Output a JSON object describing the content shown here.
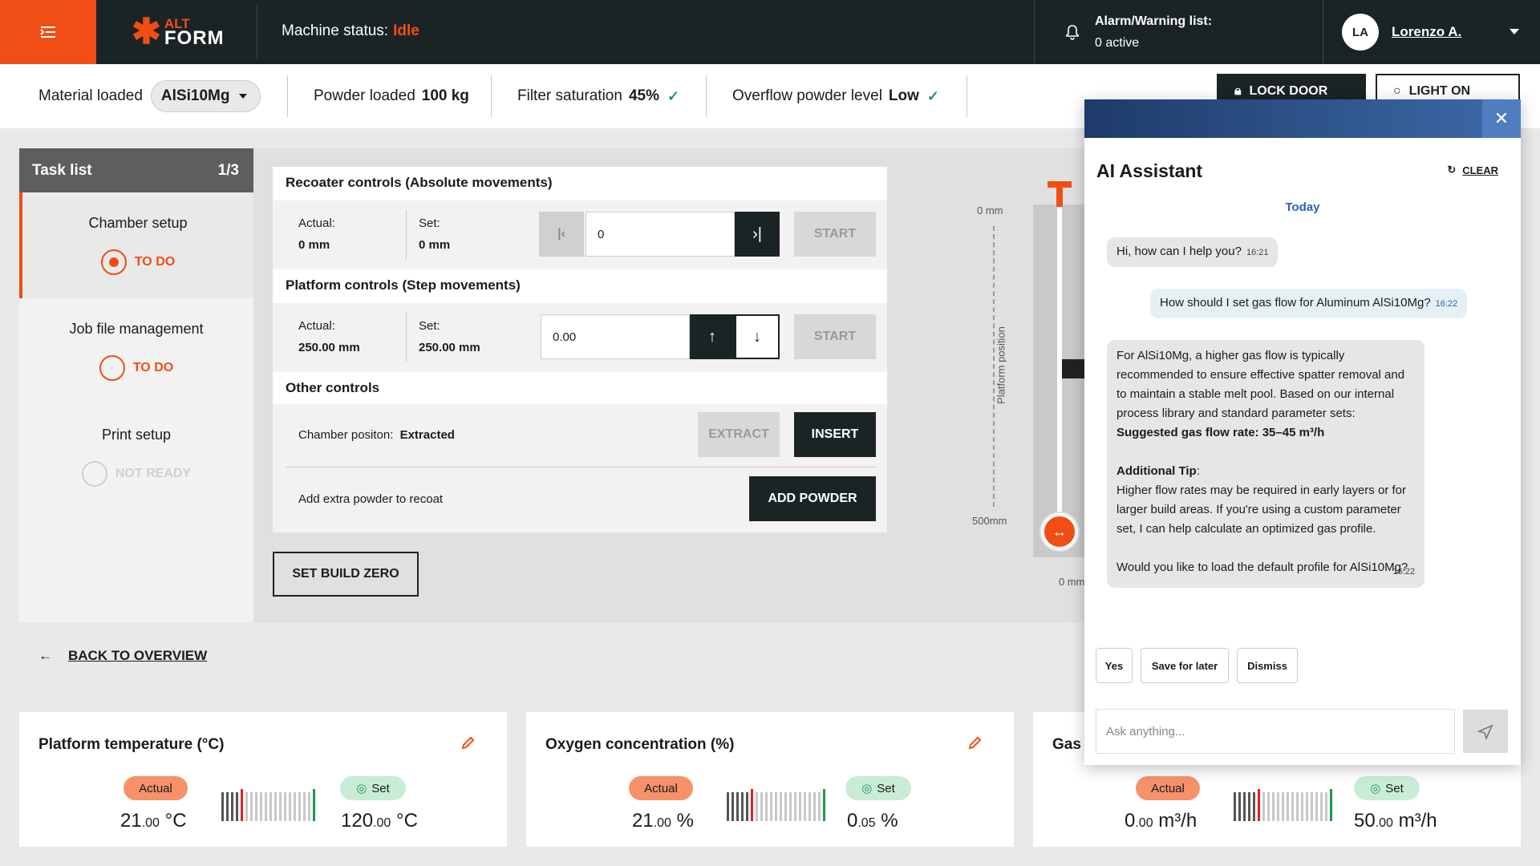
{
  "header": {
    "logo_alt": "ALT",
    "logo_form": "FORM",
    "machine_status_label": "Machine status:",
    "machine_status_value": "Idle",
    "alarm_title": "Alarm/Warning list:",
    "alarm_count": "0 active",
    "user_initials": "LA",
    "user_name": "Lorenzo A."
  },
  "status_strip": {
    "material_label": "Material loaded",
    "material_value": "AlSi10Mg",
    "powder_label": "Powder loaded",
    "powder_value": "100 kg",
    "filter_label": "Filter saturation",
    "filter_value": "45%",
    "overflow_label": "Overflow powder level",
    "overflow_value": "Low",
    "lock_door": "LOCK DOOR",
    "light_on": "LIGHT ON"
  },
  "tasks": {
    "title": "Task list",
    "progress": "1/3",
    "items": [
      {
        "name": "Chamber setup",
        "state": "TO DO"
      },
      {
        "name": "Job file management",
        "state": "TO DO"
      },
      {
        "name": "Print setup",
        "state": "NOT READY"
      }
    ]
  },
  "recoater": {
    "title": "Recoater controls (Absolute movements)",
    "actual_label": "Actual:",
    "actual_value": "0 mm",
    "set_label": "Set:",
    "set_value": "0 mm",
    "input_value": "0",
    "start": "START"
  },
  "platform": {
    "title": "Platform controls (Step movements)",
    "actual_label": "Actual:",
    "actual_value": "250.00 mm",
    "set_label": "Set:",
    "set_value": "250.00 mm",
    "input_value": "0.00",
    "start": "START"
  },
  "other": {
    "title": "Other controls",
    "chamber_label": "Chamber positon:",
    "chamber_value": "Extracted",
    "extract": "EXTRACT",
    "insert": "INSERT",
    "powder_label": "Add extra powder to recoat",
    "add_powder": "ADD POWDER"
  },
  "set_build_zero": "SET BUILD ZERO",
  "platform_visual": {
    "top_label": "0 mm",
    "bottom_label": "500mm",
    "axis_label": "Platform position",
    "x_label": "0 mm"
  },
  "back": "BACK TO OVERVIEW",
  "cards": [
    {
      "title": "Platform temperature (°C)",
      "actual": "Actual",
      "set": "Set",
      "actual_int": "21",
      "actual_dec": ".00",
      "actual_unit": " °C",
      "set_int": "120",
      "set_dec": ".00",
      "set_unit": " °C"
    },
    {
      "title": "Oxygen concentration (%)",
      "actual": "Actual",
      "set": "Set",
      "actual_int": "21",
      "actual_dec": ".00",
      "actual_unit": " %",
      "set_int": "0",
      "set_dec": ".05",
      "set_unit": " %"
    },
    {
      "title": "Gas",
      "actual": "Actual",
      "set": "Set",
      "actual_int": "0",
      "actual_dec": ".00",
      "actual_unit": " m³/h",
      "set_int": "50",
      "set_dec": ".00",
      "set_unit": " m³/h"
    }
  ],
  "assistant": {
    "title": "AI Assistant",
    "clear": "CLEAR",
    "today": "Today",
    "msg1": "Hi, how can I help you?",
    "msg1_time": "16:21",
    "msg2": "How should I set gas flow for Aluminum AlSi10Mg?",
    "msg2_time": "16:22",
    "msg3_p1": "For AlSi10Mg, a higher gas flow is typically recommended to ensure effective spatter removal and to maintain a stable melt pool. Based on our internal process library and standard parameter sets:",
    "msg3_bold": "Suggested gas flow rate: 35–45 m³/h",
    "msg3_tip_label": "Additional Tip",
    "msg3_tip": "Higher flow rates may be required in early layers or for larger build areas. If you're using a custom parameter set, I can help calculate an optimized gas profile.",
    "msg3_q": "Would you like to load the default profile for AlSi10Mg?",
    "msg3_time": "16:22",
    "quick": [
      "Yes",
      "Save for later",
      "Dismiss"
    ],
    "input_placeholder": "Ask anything..."
  },
  "colors": {
    "accent": "#f04e14",
    "dark": "#1b2424",
    "ok": "#1a9a4a",
    "link": "#2b63b0"
  }
}
